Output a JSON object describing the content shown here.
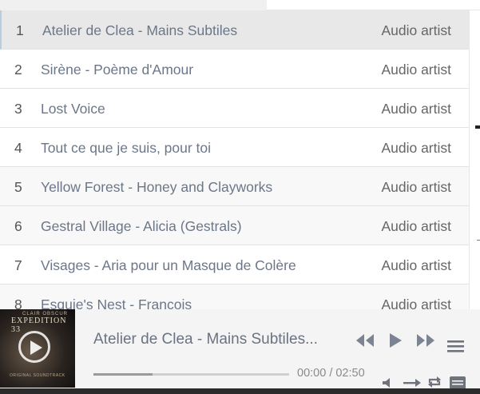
{
  "playlist": {
    "tracks": [
      {
        "num": "1",
        "title": "Atelier de Clea - Mains Subtiles",
        "artist": "Audio artist"
      },
      {
        "num": "2",
        "title": "Sirène - Poème d'Amour",
        "artist": "Audio artist"
      },
      {
        "num": "3",
        "title": "Lost Voice",
        "artist": "Audio artist"
      },
      {
        "num": "4",
        "title": "Tout ce que je suis, pour toi",
        "artist": "Audio artist"
      },
      {
        "num": "5",
        "title": "Yellow Forest - Honey and Clayworks",
        "artist": "Audio artist"
      },
      {
        "num": "6",
        "title": "Gestral Village - Alicia (Gestrals)",
        "artist": "Audio artist"
      },
      {
        "num": "7",
        "title": "Visages - Aria pour un Masque de Colère",
        "artist": "Audio artist"
      },
      {
        "num": "8",
        "title": "Esquie's Nest - Francois",
        "artist": "Audio artist"
      }
    ]
  },
  "player": {
    "cover": {
      "small_text": "CLAIR OBSCUR",
      "title_text": "EXPEDITION 33",
      "bottom_text": "ORIGINAL SOUNDTRACK"
    },
    "now_playing": "Atelier de Clea - Mains Subtiles...",
    "time": "00:00 / 02:50",
    "progress": 0.3,
    "icons": [
      "rewind-icon",
      "play-icon",
      "fast-forward-icon",
      "menu-icon",
      "volume-icon",
      "shuffle-icon",
      "repeat-icon",
      "playlist-icon"
    ]
  }
}
